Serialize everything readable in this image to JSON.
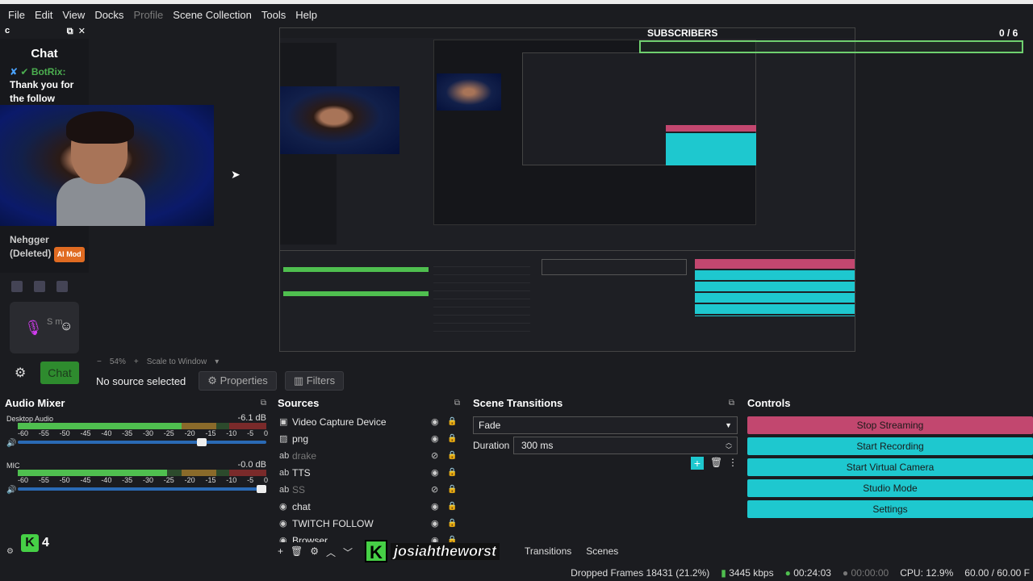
{
  "menu": [
    {
      "label": "File"
    },
    {
      "label": "Edit"
    },
    {
      "label": "View"
    },
    {
      "label": "Docks"
    },
    {
      "label": "Profile",
      "disabled": true
    },
    {
      "label": "Scene Collection"
    },
    {
      "label": "Tools"
    },
    {
      "label": "Help"
    }
  ],
  "chat_dock": {
    "header": "c",
    "title": "Chat",
    "bot_name": "BotRix:",
    "bot_message": "Thank you for the follow",
    "user_name": "Nehgger (Deleted)",
    "mod_badge": "AI Mod",
    "mic_text": "S m",
    "chat_button": "Chat"
  },
  "overlay": {
    "subscribers_label": "SUBSCRIBERS",
    "subscribers_count": "0 / 6",
    "k_count": "4",
    "watermark_name": "josiahtheworst"
  },
  "preview": {
    "zoom": "54%",
    "scale_mode": "Scale to Window"
  },
  "toolbar": {
    "no_source": "No source selected",
    "properties": "Properties",
    "filters": "Filters"
  },
  "audio_mixer": {
    "title": "Audio Mixer",
    "channels": [
      {
        "name": "Desktop Audio",
        "db": "-6.1 dB",
        "level": 0.72,
        "volume": 0.75
      },
      {
        "name": "MIC",
        "db": "-0.0 dB",
        "level": 0.6,
        "volume": 1.0
      }
    ],
    "ticks": [
      "-60",
      "-55",
      "-50",
      "-45",
      "-40",
      "-35",
      "-30",
      "-25",
      "-20",
      "-15",
      "-10",
      "-5",
      "0"
    ]
  },
  "sources": {
    "title": "Sources",
    "items": [
      {
        "label": "Video Capture Device",
        "icon": "camera-icon",
        "hidden": false
      },
      {
        "label": "png",
        "icon": "image-icon",
        "hidden": false
      },
      {
        "label": "drake",
        "icon": "text-icon",
        "hidden": true
      },
      {
        "label": "TTS",
        "icon": "text-icon",
        "hidden": false
      },
      {
        "label": "SS",
        "icon": "text-icon",
        "hidden": true
      },
      {
        "label": "chat",
        "icon": "globe-icon",
        "hidden": false
      },
      {
        "label": "TWITCH FOLLOW",
        "icon": "globe-icon",
        "hidden": false
      },
      {
        "label": "Browser",
        "icon": "globe-icon",
        "hidden": false
      }
    ]
  },
  "scene_transitions": {
    "title": "Scene Transitions",
    "transition": "Fade",
    "duration_label": "Duration",
    "duration_value": "300 ms"
  },
  "controls": {
    "title": "Controls",
    "buttons": [
      {
        "label": "Stop Streaming",
        "color": "#c2476f"
      },
      {
        "label": "Start Recording",
        "color": "#1ec8cf"
      },
      {
        "label": "Start Virtual Camera",
        "color": "#1ec8cf"
      },
      {
        "label": "Studio Mode",
        "color": "#1ec8cf"
      },
      {
        "label": "Settings",
        "color": "#1ec8cf"
      }
    ]
  },
  "bottom_tabs": [
    "Transitions",
    "Scenes"
  ],
  "status": {
    "dropped": "Dropped Frames 18431 (21.2%)",
    "bitrate": "3445 kbps",
    "live_time": "00:24:03",
    "rec_time": "00:00:00",
    "cpu": "CPU: 12.9%",
    "fps": "60.00 / 60.00 F"
  }
}
